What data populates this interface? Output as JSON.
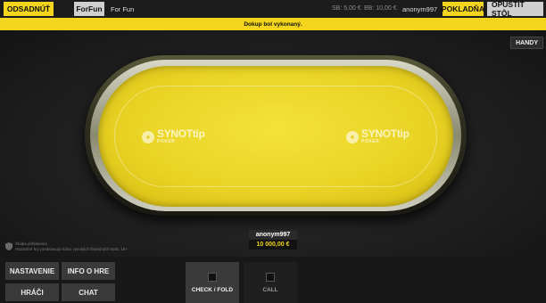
{
  "topbar": {
    "leave_button": "ODSADNÚŤ",
    "mode_badge": "ForFun",
    "mode_label": "For Fun",
    "small_blind": "SB: 5,00 €",
    "big_blind": "BB: 10,00 €",
    "username": "anonym997",
    "cashier_button": "POKLADŇA",
    "leave_table_button": "OPUSTIŤ STÔL"
  },
  "notice": "Dokup bol vykonaný.",
  "handy_button": "HANDY",
  "table": {
    "logo_left": {
      "name": "SYNOTtip",
      "sub": "POKER"
    },
    "logo_right": {
      "name": "SYNOTtip",
      "sub": "POKER"
    }
  },
  "player": {
    "name": "anonym997",
    "stack": "10 000,00 €"
  },
  "disclaimer": {
    "line1": "Štúdia prihlásenia",
    "line2": "Hazardné hry predstavujú riziko vysokých finančných strát. 18+"
  },
  "menu": {
    "settings": "NASTAVENIE",
    "game_info": "INFO O HRE",
    "players": "HRÁČI",
    "chat": "CHAT"
  },
  "actions": {
    "check_fold": "CHECK / FOLD",
    "call": "CALL"
  },
  "colors": {
    "accent": "#f2d51c",
    "felt": "#e9d223",
    "background": "#151515"
  }
}
